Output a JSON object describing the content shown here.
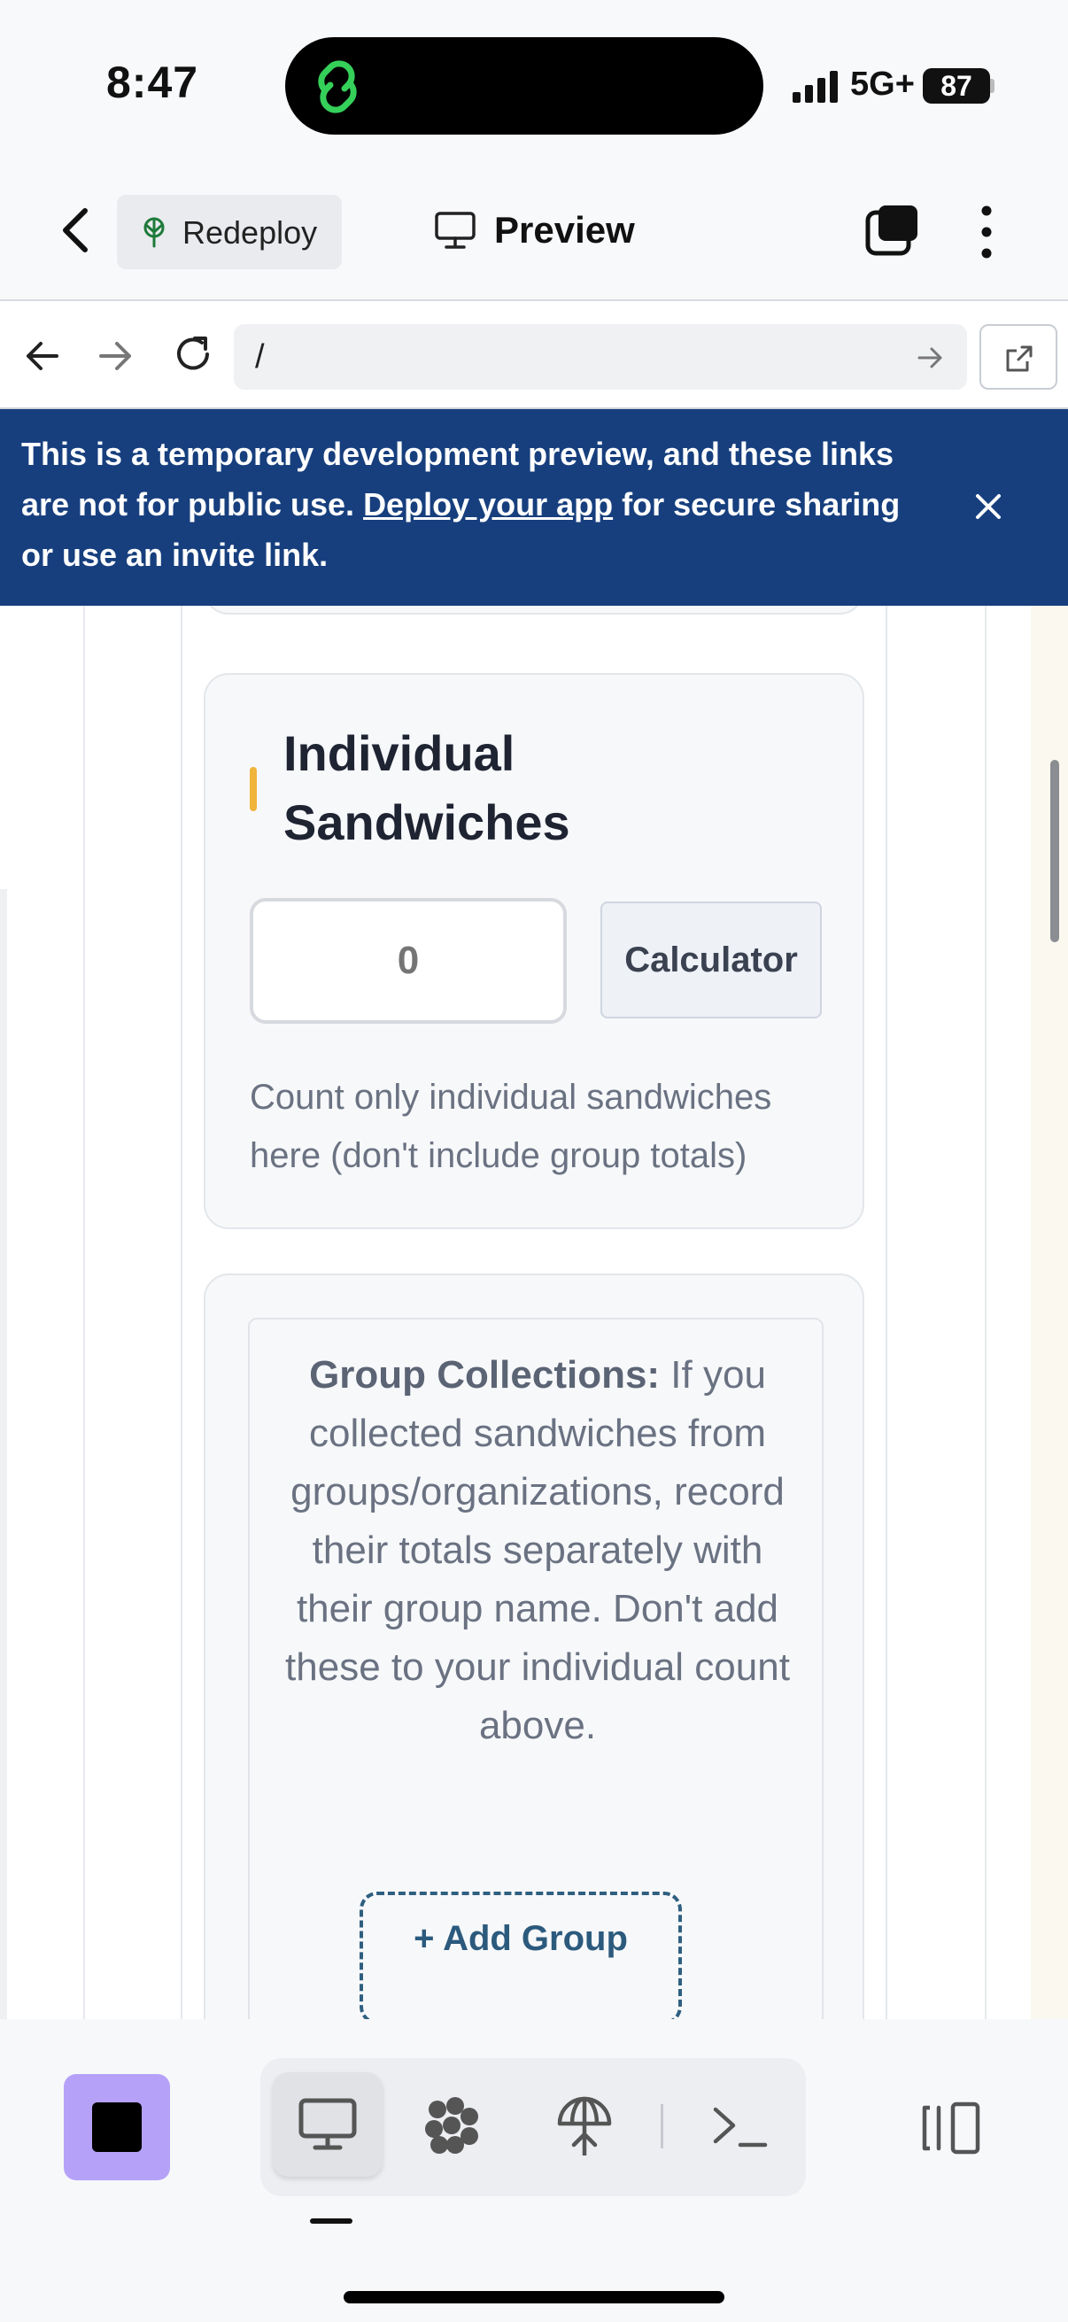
{
  "status_bar": {
    "time": "8:47",
    "network": "5G+",
    "battery": "87"
  },
  "app_header": {
    "redeploy_label": "Redeploy",
    "preview_label": "Preview"
  },
  "browser": {
    "url": "/"
  },
  "banner": {
    "text_before": "This is a temporary development preview, and these links are not for public use. ",
    "link_text": "Deploy your app",
    "text_after": " for secure sharing or use an invite link."
  },
  "sandwich_card": {
    "title": "Individual Sandwiches",
    "count_placeholder": "0",
    "calculator_label": "Calculator",
    "help_text": "Count only individual sandwiches here (don't include group totals)"
  },
  "group_card": {
    "lead": "Group Collections:",
    "body": " If you collected sandwiches from groups/organizations, record their totals separately with their group name. Don't add these to your individual count above.",
    "add_group_label": "+ Add Group"
  },
  "colors": {
    "banner_bg": "#173f7e",
    "accent": "#f0b33c",
    "stop_button": "#b5a2f8",
    "add_group": "#2c5a7d"
  },
  "icons": [
    "back-chevron-icon",
    "redeploy-icon",
    "monitor-icon",
    "tabs-icon",
    "more-vertical-icon",
    "arrow-left-icon",
    "arrow-right-icon",
    "reload-icon",
    "go-arrow-icon",
    "external-link-icon",
    "close-icon",
    "stop-icon",
    "desktop-icon",
    "workspace-icon",
    "deploy-icon",
    "terminal-icon",
    "panels-icon"
  ]
}
